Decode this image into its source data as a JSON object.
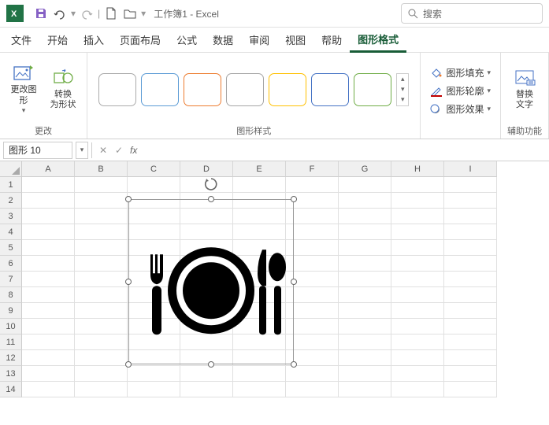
{
  "app": {
    "title": "工作簿1 - Excel"
  },
  "search": {
    "placeholder": "搜索"
  },
  "tabs": [
    {
      "label": "文件",
      "active": false
    },
    {
      "label": "开始",
      "active": false
    },
    {
      "label": "插入",
      "active": false
    },
    {
      "label": "页面布局",
      "active": false
    },
    {
      "label": "公式",
      "active": false
    },
    {
      "label": "数据",
      "active": false
    },
    {
      "label": "审阅",
      "active": false
    },
    {
      "label": "视图",
      "active": false
    },
    {
      "label": "帮助",
      "active": false
    },
    {
      "label": "图形格式",
      "active": true
    }
  ],
  "ribbon": {
    "change_group_label": "更改",
    "change_graphic": "更改图\n形",
    "convert_shape": "转换\n为形状",
    "styles_group_label": "图形样式",
    "shape_fill": "图形填充",
    "shape_outline": "图形轮廓",
    "shape_effects": "图形效果",
    "alt_text": "替换\n文字",
    "alt_group_label": "辅助功能"
  },
  "formula_bar": {
    "name_box": "图形 10",
    "fx": "fx"
  },
  "columns": [
    "A",
    "B",
    "C",
    "D",
    "E",
    "F",
    "G",
    "H",
    "I"
  ],
  "rows": [
    "1",
    "2",
    "3",
    "4",
    "5",
    "6",
    "7",
    "8",
    "9",
    "10",
    "11",
    "12",
    "13",
    "14"
  ]
}
